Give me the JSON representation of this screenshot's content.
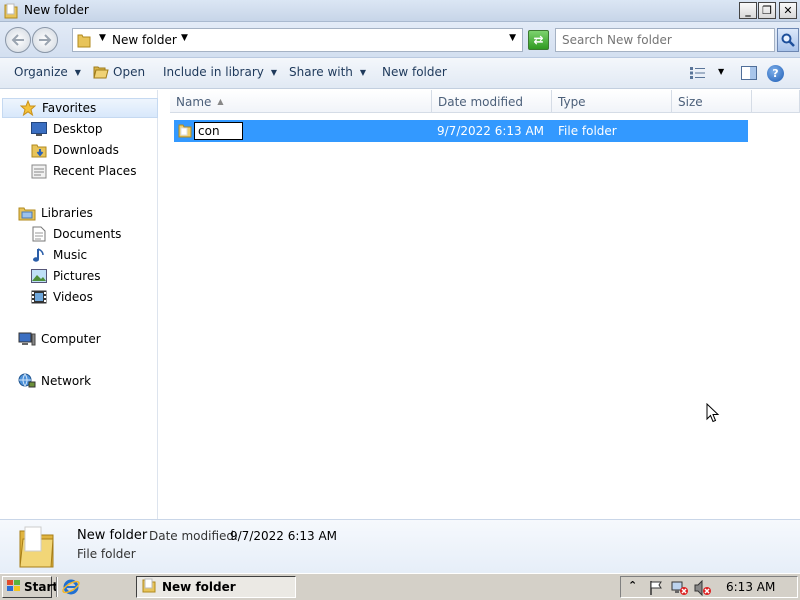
{
  "window": {
    "title": "New folder",
    "buttons": {
      "minimize": "_",
      "maximize": "❐",
      "close": "✕"
    }
  },
  "address": {
    "path": "New folder",
    "search_placeholder": "Search New folder"
  },
  "toolbar": {
    "organize": "Organize",
    "open": "Open",
    "include_in_library": "Include in library",
    "share_with": "Share with",
    "new_folder": "New folder"
  },
  "nav": {
    "favorites": "Favorites",
    "desktop": "Desktop",
    "downloads": "Downloads",
    "recent_places": "Recent Places",
    "libraries": "Libraries",
    "documents": "Documents",
    "music": "Music",
    "pictures": "Pictures",
    "videos": "Videos",
    "computer": "Computer",
    "network": "Network"
  },
  "columns": {
    "name": "Name",
    "date_modified": "Date modified",
    "type": "Type",
    "size": "Size"
  },
  "files": [
    {
      "name": "con",
      "date_modified": "9/7/2022 6:13 AM",
      "type": "File folder"
    }
  ],
  "details": {
    "name": "New folder",
    "date_label": "Date modified:",
    "date": "9/7/2022 6:13 AM",
    "type": "File folder"
  },
  "taskbar": {
    "start": "Start",
    "task": "New folder",
    "clock": "6:13 AM"
  },
  "colors": {
    "selection": "#3399ff",
    "accent_text": "#1e395b"
  },
  "icons": {
    "folder": "folder-icon",
    "star": "star-icon",
    "help": "help-icon"
  }
}
